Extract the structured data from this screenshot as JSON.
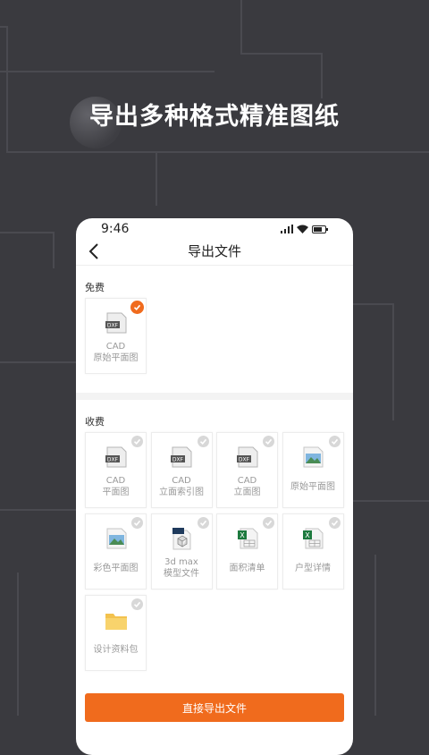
{
  "promo": {
    "title": "导出多种格式精准图纸"
  },
  "status_bar": {
    "time": "9:46"
  },
  "nav": {
    "title": "导出文件"
  },
  "colors": {
    "accent": "#f06b1d",
    "background": "#3a3a3f"
  },
  "free_section": {
    "label": "免费",
    "items": [
      {
        "icon": "dxf-file-icon",
        "line1": "CAD",
        "line2": "原始平面图",
        "selected": true
      }
    ]
  },
  "paid_section": {
    "label": "收费",
    "items": [
      {
        "icon": "dxf-file-icon",
        "line1": "CAD",
        "line2": "平面图",
        "selected": false
      },
      {
        "icon": "dxf-file-icon",
        "line1": "CAD",
        "line2": "立面索引图",
        "selected": false
      },
      {
        "icon": "dxf-file-icon",
        "line1": "CAD",
        "line2": "立面图",
        "selected": false
      },
      {
        "icon": "image-file-icon",
        "line1": "原始平面图",
        "selected": false
      },
      {
        "icon": "image-file-icon",
        "line1": "彩色平面图",
        "selected": false
      },
      {
        "icon": "3d-max-file-icon",
        "line1": "3d max",
        "line2": "模型文件",
        "selected": false
      },
      {
        "icon": "excel-file-icon",
        "line1": "面积清单",
        "selected": false
      },
      {
        "icon": "excel-file-icon",
        "line1": "户型详情",
        "selected": false
      },
      {
        "icon": "folder-icon",
        "line1": "设计资料包",
        "selected": false
      }
    ]
  },
  "actions": {
    "export_label": "直接导出文件"
  }
}
